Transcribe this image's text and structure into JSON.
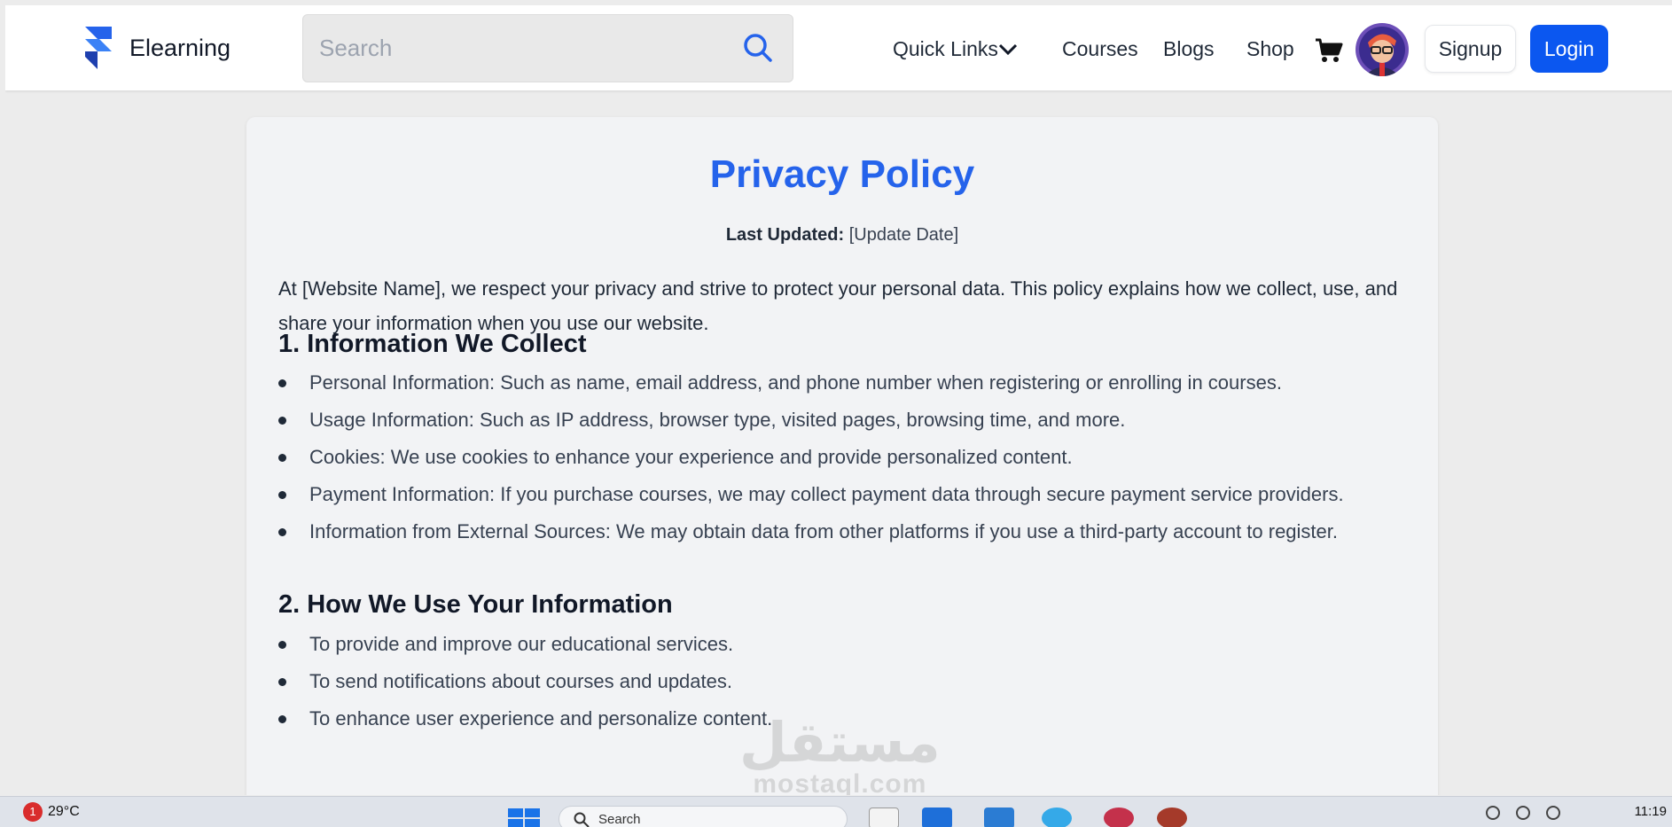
{
  "header": {
    "brand": "Elearning",
    "search_placeholder": "Search",
    "nav": {
      "quick_links": "Quick Links",
      "courses": "Courses",
      "blogs": "Blogs",
      "shop": "Shop"
    },
    "signup_label": "Signup",
    "login_label": "Login",
    "accent_color": "#0b57f0"
  },
  "policy": {
    "title": "Privacy Policy",
    "last_updated_label": "Last Updated:",
    "last_updated_value": "[Update Date]",
    "intro": "At [Website Name], we respect your privacy and strive to protect your personal data. This policy explains how we collect, use, and share your information when you use our website.",
    "sections": [
      {
        "heading": "1. Information We Collect",
        "items": [
          "Personal Information: Such as name, email address, and phone number when registering or enrolling in courses.",
          "Usage Information: Such as IP address, browser type, visited pages, browsing time, and more.",
          "Cookies: We use cookies to enhance your experience and provide personalized content.",
          "Payment Information: If you purchase courses, we may collect payment data through secure payment service providers.",
          "Information from External Sources: We may obtain data from other platforms if you use a third-party account to register."
        ]
      },
      {
        "heading": "2. How We Use Your Information",
        "items": [
          "To provide and improve our educational services.",
          "To send notifications about courses and updates.",
          "To enhance user experience and personalize content."
        ]
      }
    ]
  },
  "watermark": {
    "arabic": "مستقل",
    "latin": "mostaql.com"
  },
  "taskbar": {
    "weather_badge": "1",
    "temperature": "29°C",
    "search_text": "Search",
    "clock": "11:19"
  }
}
